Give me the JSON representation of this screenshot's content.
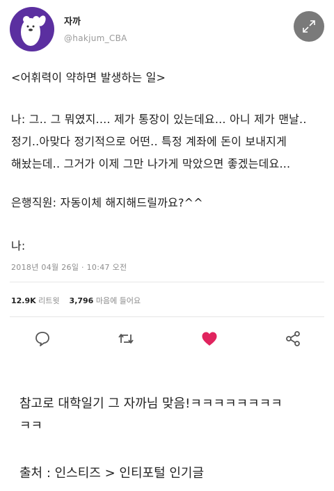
{
  "profile": {
    "username": "자까",
    "handle": "@hakjum_CBA"
  },
  "tweet": {
    "title": "<어휘력이 약하면 발생하는 일>",
    "lines": [
      "나: 그.. 그 뭐였지.... 제가 통장이 있는데요... 아니 제가 맨날..",
      "정기..아맞다 정기적으로 어떤.. 특정 계좌에 돈이 보내지게",
      "해놨는데.. 그거가 이제 그만 나가게 막았으면 좋겠는데요...",
      "은행직원: 자동이체 해지해드릴까요?^^",
      "나:"
    ],
    "timestamp": "2018년 04월 26일 · 10:47 오전",
    "retweets_count": "12.9K",
    "retweets_label": "리트윗",
    "likes_count": "3,796",
    "likes_label": "마음에 들어요"
  },
  "icons": {
    "expand": "expand-arrows-icon",
    "reply": "reply-bubble-icon",
    "retweet": "retweet-icon",
    "like": "heart-icon",
    "share": "share-icon"
  },
  "colors": {
    "avatar_bg": "#5b2fa0",
    "like_red": "#e0245e",
    "muted": "#8c8c8c"
  },
  "caption": {
    "line1": "참고로 대학일기 그 자까님 맞음!ㅋㅋㅋㅋㅋㅋㅋㅋ",
    "line2": "ㅋㅋ",
    "source": "출처 : 인스티즈 > 인티포털 인기글"
  }
}
